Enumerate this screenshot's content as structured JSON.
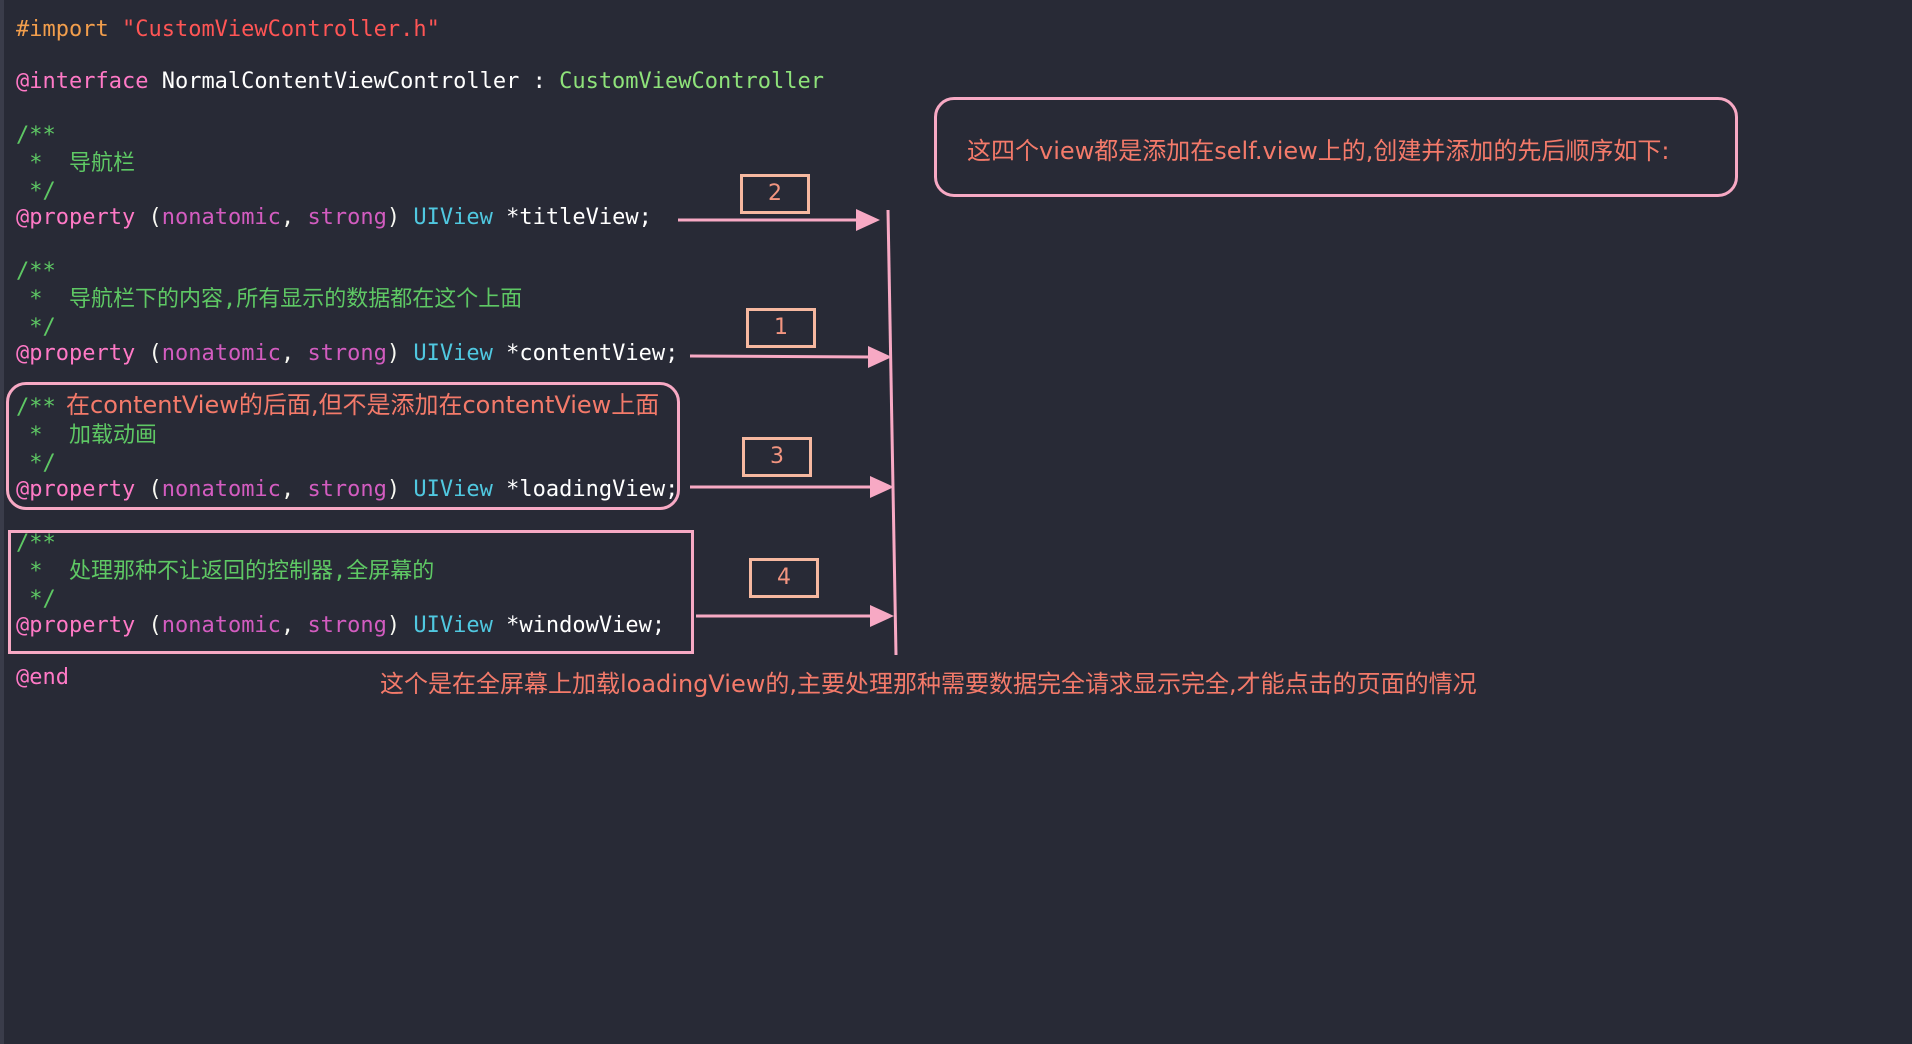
{
  "code": {
    "import_kw": "#import",
    "import_str": "\"CustomViewController.h\"",
    "interface_kw": "@interface",
    "class_name": "NormalContentViewController",
    "colon": " : ",
    "super_class": "CustomViewController",
    "comment_open": "/**",
    "comment_star": " *  ",
    "comment_close": " */",
    "property_kw": "@property",
    "nonatomic": "nonatomic",
    "strong": "strong",
    "uiview": "UIView",
    "comment_title": "导航栏",
    "comment_content": "导航栏下的内容,所有显示的数据都在这个上面",
    "comment_loading": "加载动画",
    "comment_window": "处理那种不让返回的控制器,全屏幕的",
    "prop_title": "*titleView;",
    "prop_content": "*contentView;",
    "prop_loading": "*loadingView;",
    "prop_window": "*windowView;",
    "end_kw": "@end"
  },
  "annotations": {
    "top_note": "这四个view都是添加在self.view上的,创建并添加的先后顺序如下:",
    "loading_note": "在contentView的后面,但不是添加在contentView上面",
    "bottom_note": "这个是在全屏幕上加载loadingView的,主要处理那种需要数据完全请求显示完全,才能点击的页面的情况",
    "order_title": "2",
    "order_content": "1",
    "order_loading": "3",
    "order_window": "4"
  },
  "colors": {
    "background": "#282a36",
    "annotation_line": "#f7a9c4",
    "number_box": "#f6b8a0",
    "note_text": "#f47a6a"
  }
}
